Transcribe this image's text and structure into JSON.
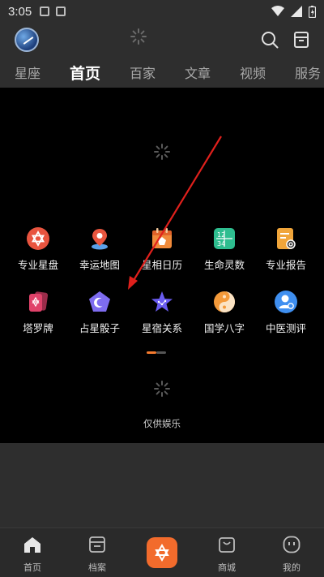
{
  "status_bar": {
    "time": "3:05"
  },
  "header": {
    "avatar_icon": "constellation-avatar",
    "actions": [
      "search-icon",
      "archive-icon"
    ]
  },
  "tabs": [
    {
      "label": "星座",
      "active": false
    },
    {
      "label": "首页",
      "active": true
    },
    {
      "label": "百家",
      "active": false
    },
    {
      "label": "文章",
      "active": false
    },
    {
      "label": "视频",
      "active": false
    },
    {
      "label": "服务",
      "active": false
    }
  ],
  "tools": {
    "row1": [
      {
        "label": "专业星盘",
        "icon": "star-of-david-icon",
        "color": "#e8543f"
      },
      {
        "label": "幸运地图",
        "icon": "map-pin-icon",
        "color": "#e8553e"
      },
      {
        "label": "星相日历",
        "icon": "calendar-icon",
        "color": "#f08a3a"
      },
      {
        "label": "生命灵数",
        "icon": "numbers-grid-icon",
        "color": "#2ebd8f"
      },
      {
        "label": "专业报告",
        "icon": "report-icon",
        "color": "#f0a53a"
      }
    ],
    "row2": [
      {
        "label": "塔罗牌",
        "icon": "tarot-cards-icon",
        "color": "#e0426a"
      },
      {
        "label": "占星骰子",
        "icon": "moon-dice-icon",
        "color": "#7e6cf0"
      },
      {
        "label": "星宿关系",
        "icon": "star-constellation-icon",
        "color": "#6a5cf0"
      },
      {
        "label": "国学八字",
        "icon": "yin-yang-icon",
        "color": "#f49a3a"
      },
      {
        "label": "中医测评",
        "icon": "doctor-icon",
        "color": "#3f8ff0"
      }
    ]
  },
  "disclaimer": "仅供娱乐",
  "bottom_nav": [
    {
      "label": "首页",
      "icon": "home-icon"
    },
    {
      "label": "档案",
      "icon": "folder-icon"
    },
    {
      "label": "",
      "icon": "star-of-david-icon"
    },
    {
      "label": "商城",
      "icon": "shopping-bag-icon"
    },
    {
      "label": "我的",
      "icon": "profile-face-icon"
    }
  ]
}
